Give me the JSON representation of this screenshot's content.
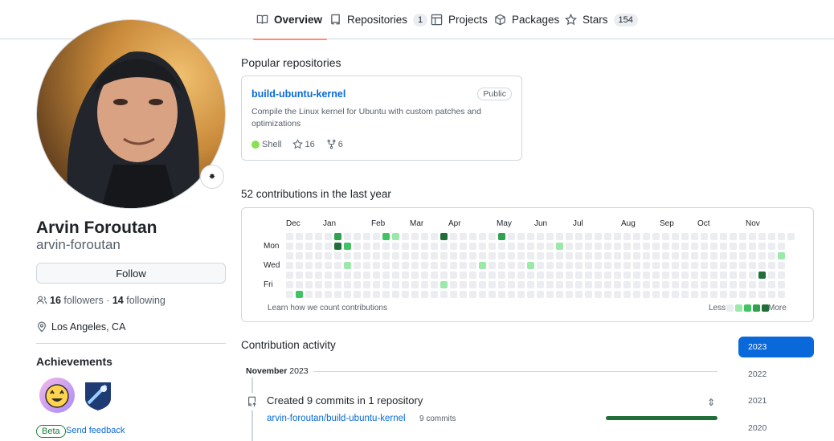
{
  "nav": {
    "tabs": [
      {
        "label": "Overview",
        "counter": null,
        "icon": "book-icon"
      },
      {
        "label": "Repositories",
        "counter": "1",
        "icon": "repo-icon"
      },
      {
        "label": "Projects",
        "counter": null,
        "icon": "table-icon"
      },
      {
        "label": "Packages",
        "counter": null,
        "icon": "package-icon"
      },
      {
        "label": "Stars",
        "counter": "154",
        "icon": "star-icon"
      }
    ],
    "active_tab": "Overview",
    "active_underline_color": "#fd8c73"
  },
  "profile": {
    "name": "Arvin Foroutan",
    "login": "arvin-foroutan",
    "follow_label": "Follow",
    "followers_count": "16",
    "followers_label": "followers",
    "separator": "·",
    "following_count": "14",
    "following_label": "following",
    "location": "Los Angeles, CA",
    "achievements_title": "Achievements",
    "beta_label": "Beta",
    "feedback_label": "Send feedback"
  },
  "popular": {
    "title": "Popular repositories",
    "repo": {
      "name": "build-ubuntu-kernel",
      "visibility": "Public",
      "description": "Compile the Linux kernel for Ubuntu with custom patches and optimizations",
      "language": "Shell",
      "language_color": "#89e051",
      "stars": "16",
      "forks": "6"
    }
  },
  "contributions": {
    "title": "52 contributions in the last year",
    "months": [
      "Dec",
      "Jan",
      "Feb",
      "Mar",
      "Apr",
      "May",
      "Jun",
      "Jul",
      "Aug",
      "Sep",
      "Oct",
      "Nov"
    ],
    "days": [
      "Mon",
      "Wed",
      "Fri"
    ],
    "learn_label": "Learn how we count contributions",
    "less_label": "Less",
    "more_label": "More",
    "level_colors": [
      "#ebedf0",
      "#9be9a8",
      "#40c463",
      "#30a14e",
      "#216e39"
    ],
    "weeks": 53,
    "cells": [
      {
        "week": 5,
        "day": 0,
        "level": 3
      },
      {
        "week": 5,
        "day": 1,
        "level": 4
      },
      {
        "week": 6,
        "day": 1,
        "level": 2
      },
      {
        "week": 6,
        "day": 3,
        "level": 1
      },
      {
        "week": 1,
        "day": 6,
        "level": 2
      },
      {
        "week": 10,
        "day": 0,
        "level": 2
      },
      {
        "week": 11,
        "day": 0,
        "level": 1
      },
      {
        "week": 16,
        "day": 0,
        "level": 4
      },
      {
        "week": 16,
        "day": 5,
        "level": 1
      },
      {
        "week": 20,
        "day": 3,
        "level": 1
      },
      {
        "week": 22,
        "day": 0,
        "level": 3
      },
      {
        "week": 25,
        "day": 3,
        "level": 1
      },
      {
        "week": 28,
        "day": 1,
        "level": 1
      },
      {
        "week": 49,
        "day": 4,
        "level": 4
      },
      {
        "week": 51,
        "day": 2,
        "level": 1
      }
    ]
  },
  "activity": {
    "title": "Contribution activity",
    "month_heading": "November",
    "month_year": "2023",
    "summary": "Created 9 commits in 1 repository",
    "repo": "arvin-foroutan/build-ubuntu-kernel",
    "commits": "9 commits",
    "bar_color": "#216e39",
    "expand_icon": "fold-icon"
  },
  "years": [
    "2023",
    "2022",
    "2021",
    "2020"
  ],
  "selected_year": "2023",
  "accent_color": "#0969da"
}
